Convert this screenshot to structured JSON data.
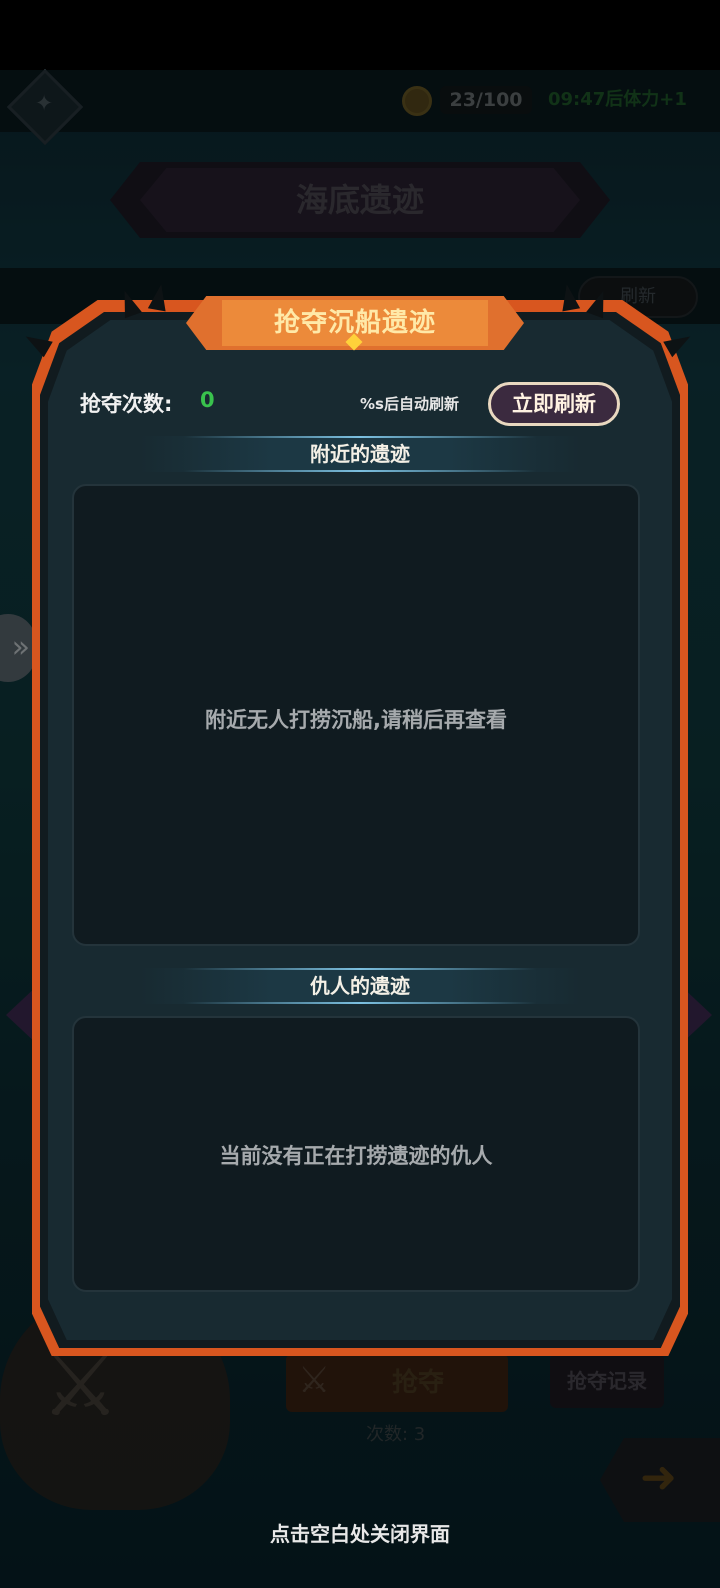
{
  "background": {
    "stamina": "23/100",
    "stamina_timer": "09:47后体力+1",
    "title": "海底遗迹",
    "refresh_label": "刷新",
    "grab_label": "抢夺",
    "record_label": "抢夺记录",
    "count_text": "次数: 3"
  },
  "dialog": {
    "title": "抢夺沉船遗迹",
    "rob_count_label": "抢夺次数:",
    "rob_count_value": "0",
    "auto_refresh_text": "%s后自动刷新",
    "refresh_now_label": "立即刷新",
    "nearby": {
      "heading": "附近的遗迹",
      "empty_text": "附近无人打捞沉船,请稍后再查看"
    },
    "enemy": {
      "heading": "仇人的遗迹",
      "empty_text": "当前没有正在打捞遗迹的仇人"
    }
  },
  "close_hint": "点击空白处关闭界面",
  "colors": {
    "accent_orange": "#e0702e",
    "count_green": "#39c24d",
    "panel_bg": "#101b20",
    "modal_bg": "#182a31"
  },
  "icons": [
    "home-icon",
    "compass-icon",
    "crossed-swords-icon",
    "arrow-right-icon",
    "chevron-right-icon"
  ]
}
